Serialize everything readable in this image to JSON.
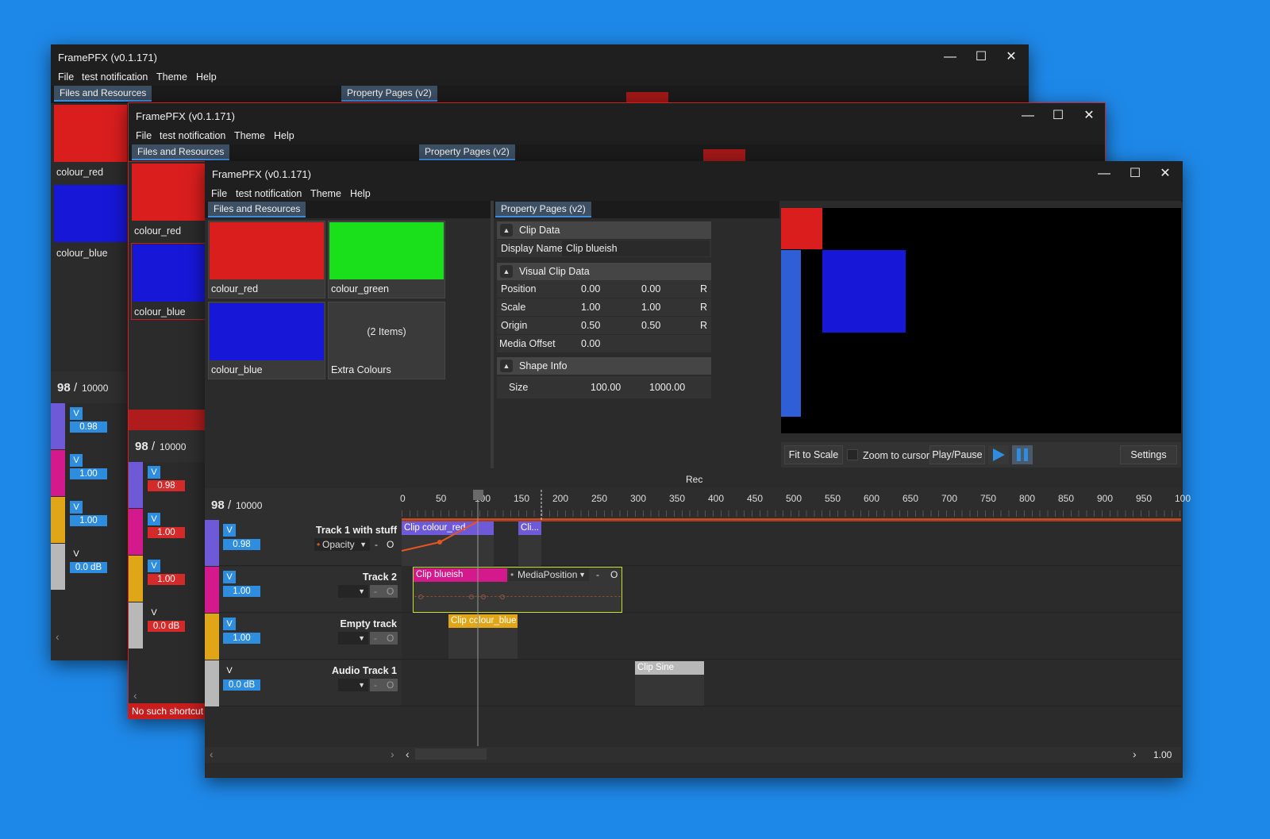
{
  "app_title": "FramePFX (v0.1.171)",
  "window_controls": {
    "minimize": "—",
    "maximize": "☐",
    "close": "✕"
  },
  "menu": [
    "File",
    "test notification",
    "Theme",
    "Help"
  ],
  "tabs": {
    "resources": "Files and Resources",
    "properties": "Property Pages (v2)"
  },
  "resources": [
    {
      "name": "colour_red",
      "color": "#da1e1e"
    },
    {
      "name": "colour_green",
      "color": "#19e01a"
    },
    {
      "name": "colour_blue",
      "color": "#1717d8"
    },
    {
      "name": "Extra Colours",
      "inner": "(2 Items)"
    }
  ],
  "properties": {
    "clip_data": {
      "header": "Clip Data",
      "display_name_label": "Display Name",
      "display_name_value": "Clip blueish"
    },
    "visual_clip_data": {
      "header": "Visual Clip Data",
      "rows": [
        {
          "label": "Position",
          "x": "0.00",
          "y": "0.00",
          "reset": "R"
        },
        {
          "label": "Scale",
          "x": "1.00",
          "y": "1.00",
          "reset": "R"
        },
        {
          "label": "Origin",
          "x": "0.50",
          "y": "0.50",
          "reset": "R"
        }
      ],
      "media_offset_label": "Media Offset",
      "media_offset_value": "0.00"
    },
    "shape_info": {
      "header": "Shape Info",
      "size_label": "Size",
      "w": "100.00",
      "h": "1000.00"
    }
  },
  "preview_controls": {
    "fit": "Fit to Scale",
    "zoom_to_cursor": "Zoom to cursor",
    "play_pause": "Play/Pause",
    "settings": "Settings"
  },
  "timeline": {
    "rec_label": "Rec",
    "frame": "98",
    "separator": "/",
    "total": "10000",
    "ruler": [
      "0",
      "50",
      "100",
      "150",
      "200",
      "250",
      "300",
      "350",
      "400",
      "450",
      "500",
      "550",
      "600",
      "650",
      "700",
      "750",
      "800",
      "850",
      "900",
      "950",
      "100"
    ],
    "zoom": "1.00",
    "tracks": [
      {
        "name": "Track 1 with stuff",
        "color": "#6e5ad6",
        "value": "0.98",
        "param": "Opacity",
        "minus": "-",
        "o": "O"
      },
      {
        "name": "Track 2",
        "color": "#d4198c",
        "value": "1.00",
        "minus": "-",
        "o": "O"
      },
      {
        "name": "Empty track",
        "color": "#e0a617",
        "value": "1.00",
        "minus": "-",
        "o": "O"
      },
      {
        "name": "Audio Track 1",
        "color": "#b8b8b8",
        "value": "0.0 dB",
        "minus": "-",
        "o": "O"
      }
    ],
    "v_label": "V",
    "clips": [
      {
        "label": "Clip colour_red",
        "color": "#6e5ad6"
      },
      {
        "label": "Cli...",
        "color": "#6e5ad6"
      },
      {
        "label": "Clip blueish",
        "color": "#d4198c",
        "param": "MediaPosition",
        "minus": "-",
        "o": "O"
      },
      {
        "label": "Clip colour_blue",
        "color": "#e0a617"
      },
      {
        "label": "Clip Sine",
        "color": "#b8b8b8"
      }
    ]
  },
  "status": {
    "message": "No such shortcut"
  },
  "scroll": {
    "left": "‹",
    "right": "›"
  }
}
